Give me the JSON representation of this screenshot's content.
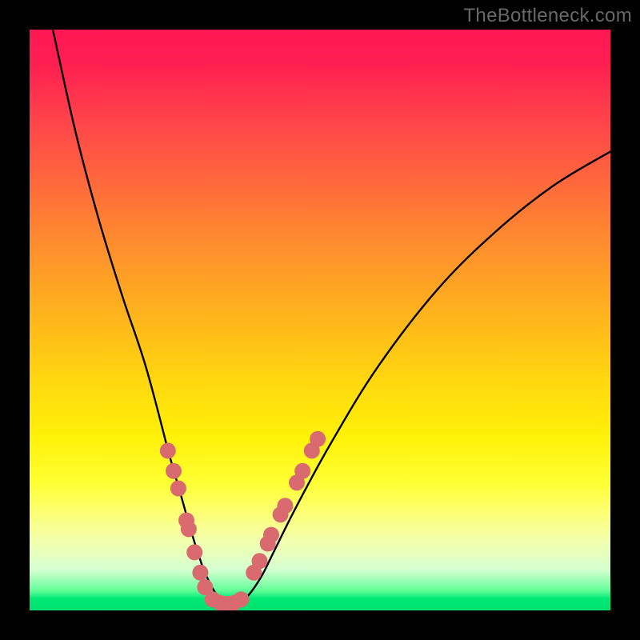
{
  "watermark": "TheBottleneck.com",
  "chart_data": {
    "type": "line",
    "title": "",
    "xlabel": "",
    "ylabel": "",
    "xlim": [
      0,
      100
    ],
    "ylim": [
      0,
      100
    ],
    "gradient_background": {
      "top_color": "#ff1753",
      "bottom_color": "#00e070",
      "description": "vertical red-orange-yellow-green gradient"
    },
    "series": [
      {
        "name": "bottleneck-curve",
        "description": "V-shaped curve, minimum near x≈34, left arm steep, right arm shallow",
        "x": [
          4,
          8,
          12,
          16,
          20,
          24,
          26,
          28,
          30,
          32,
          34,
          36,
          38,
          40,
          42,
          46,
          52,
          60,
          70,
          80,
          90,
          100
        ],
        "y": [
          100,
          82,
          67,
          54,
          42,
          27,
          20,
          13,
          7,
          3,
          1,
          1,
          3,
          6,
          10,
          18,
          29,
          42,
          55,
          65,
          73,
          79
        ],
        "color": "#000000"
      },
      {
        "name": "markers-left-arm",
        "type": "scatter",
        "x": [
          23.8,
          24.8,
          25.6,
          27.0,
          27.4,
          28.4,
          29.4,
          30.2
        ],
        "y": [
          27.5,
          24.0,
          21.0,
          15.5,
          14.0,
          10.0,
          6.5,
          4.0
        ],
        "color": "#d96a6f"
      },
      {
        "name": "markers-valley",
        "type": "scatter",
        "x": [
          31.5,
          32.8,
          34.0,
          35.2,
          36.4
        ],
        "y": [
          1.9,
          1.3,
          1.1,
          1.3,
          1.9
        ],
        "color": "#d96a6f"
      },
      {
        "name": "markers-right-arm",
        "type": "scatter",
        "x": [
          38.6,
          39.6,
          41.0,
          41.6,
          43.2,
          44.0,
          46.0,
          47.0,
          48.6,
          49.6
        ],
        "y": [
          6.5,
          8.5,
          11.5,
          13.0,
          16.5,
          18.0,
          22.0,
          24.0,
          27.5,
          29.5
        ],
        "color": "#d96a6f"
      }
    ]
  }
}
